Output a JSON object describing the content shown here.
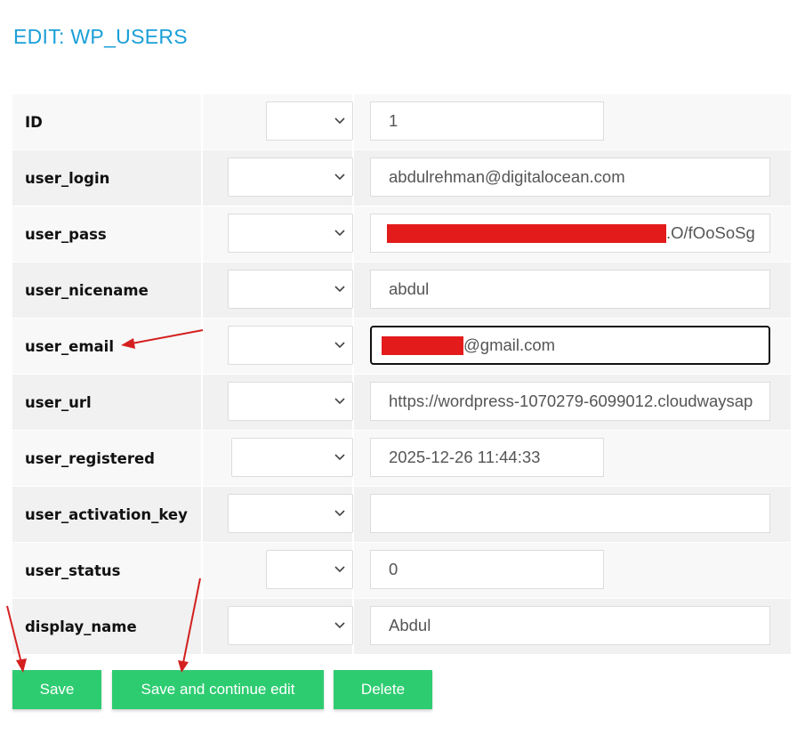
{
  "page": {
    "title": "EDIT: WP_USERS"
  },
  "fields": [
    {
      "name": "ID",
      "value": "1"
    },
    {
      "name": "user_login",
      "value": "abdulrehman@digitalocean.com"
    },
    {
      "name": "user_pass",
      "value": ".O/fOoSoSg"
    },
    {
      "name": "user_nicename",
      "value": "abdul"
    },
    {
      "name": "user_email",
      "value": "@gmail.com"
    },
    {
      "name": "user_url",
      "value": "https://wordpress-1070279-6099012.cloudwaysap"
    },
    {
      "name": "user_registered",
      "value": "2025-12-26 11:44:33"
    },
    {
      "name": "user_activation_key",
      "value": ""
    },
    {
      "name": "user_status",
      "value": "0"
    },
    {
      "name": "display_name",
      "value": "Abdul"
    }
  ],
  "buttons": {
    "save": "Save",
    "save_continue": "Save and continue edit",
    "delete": "Delete"
  },
  "colors": {
    "title": "#1a9fd8",
    "button": "#2ecc71",
    "redaction": "#e31b1b",
    "annotation_arrow": "#d42020"
  },
  "icons": {
    "select": "chevron-down-icon"
  }
}
